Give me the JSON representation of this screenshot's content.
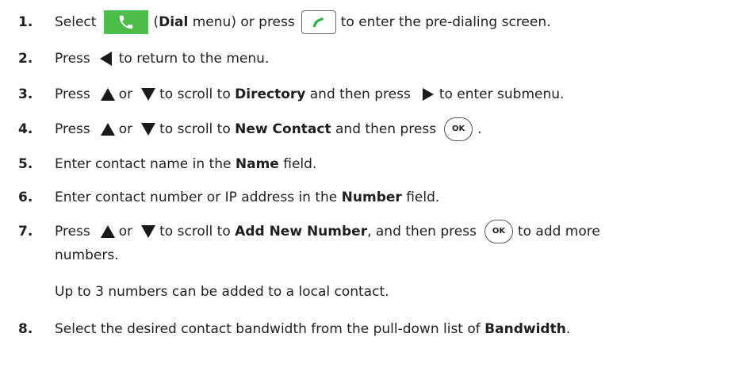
{
  "steps": [
    {
      "num": "1.",
      "t1": "Select",
      "t2": "(",
      "b1": "Dial",
      "t3": "menu) or press",
      "t4": "to enter the pre-dialing screen."
    },
    {
      "num": "2.",
      "t1": "Press",
      "t2": "to return to the menu."
    },
    {
      "num": "3.",
      "t1": "Press",
      "t2": "or",
      "t3": "to scroll to",
      "b1": "Directory",
      "t4": "and then press",
      "t5": "to enter submenu."
    },
    {
      "num": "4.",
      "t1": "Press",
      "t2": "or",
      "t3": "to scroll to",
      "b1": "New Contact",
      "t4": "and then press",
      "t5": "."
    },
    {
      "num": "5.",
      "t1": "Enter contact name in the",
      "b1": "Name",
      "t2": "field."
    },
    {
      "num": "6.",
      "t1": "Enter contact number or IP address in the",
      "b1": "Number",
      "t2": "field."
    },
    {
      "num": "7.",
      "t1": "Press",
      "t2": "or",
      "t3": "to scroll to",
      "b1": "Add New Number",
      "t4": ", and then press",
      "t5": "to add more",
      "cont": "numbers.",
      "note": "Up to 3 numbers can be added to a local contact."
    },
    {
      "num": "8.",
      "t1": "Select the desired contact bandwidth from the pull-down list of",
      "b1": "Bandwidth",
      "t2": "."
    }
  ],
  "keys": {
    "ok_label": "OK"
  },
  "icon_names": [
    "phone-icon",
    "handset-icon",
    "left-arrow-icon",
    "up-arrow-icon",
    "down-arrow-icon",
    "right-arrow-icon",
    "ok-key-icon"
  ],
  "colors": {
    "dial_icon_bg": "#4dbd4a",
    "handset_green": "#2db34a",
    "text": "#1f1f1f"
  }
}
